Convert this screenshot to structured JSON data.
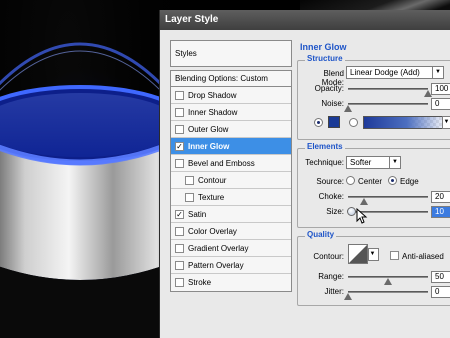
{
  "dialog": {
    "title": "Layer Style"
  },
  "left_panel": {
    "styles_label": "Styles",
    "blending_options_label": "Blending Options: Custom",
    "effects": [
      {
        "label": "Drop Shadow",
        "checked": false,
        "selected": false,
        "indent": false
      },
      {
        "label": "Inner Shadow",
        "checked": false,
        "selected": false,
        "indent": false
      },
      {
        "label": "Outer Glow",
        "checked": false,
        "selected": false,
        "indent": false
      },
      {
        "label": "Inner Glow",
        "checked": true,
        "selected": true,
        "indent": false
      },
      {
        "label": "Bevel and Emboss",
        "checked": false,
        "selected": false,
        "indent": false
      },
      {
        "label": "Contour",
        "checked": false,
        "selected": false,
        "indent": true
      },
      {
        "label": "Texture",
        "checked": false,
        "selected": false,
        "indent": true
      },
      {
        "label": "Satin",
        "checked": true,
        "selected": false,
        "indent": false
      },
      {
        "label": "Color Overlay",
        "checked": false,
        "selected": false,
        "indent": false
      },
      {
        "label": "Gradient Overlay",
        "checked": false,
        "selected": false,
        "indent": false
      },
      {
        "label": "Pattern Overlay",
        "checked": false,
        "selected": false,
        "indent": false
      },
      {
        "label": "Stroke",
        "checked": false,
        "selected": false,
        "indent": false
      }
    ]
  },
  "inner_glow": {
    "title": "Inner Glow",
    "structure": {
      "title": "Structure",
      "blend_mode_label": "Blend Mode:",
      "blend_mode_value": "Linear Dodge (Add)",
      "opacity_label": "Opacity:",
      "opacity_value": "100",
      "opacity_level": 1.0,
      "noise_label": "Noise:",
      "noise_value": "0",
      "noise_level": 0.0,
      "percent_sign": "%",
      "color": "#1a3a96"
    },
    "elements": {
      "title": "Elements",
      "technique_label": "Technique:",
      "technique_value": "Softer",
      "source_label": "Source:",
      "source_center_label": "Center",
      "source_edge_label": "Edge",
      "source_selected": "Edge",
      "choke_label": "Choke:",
      "choke_value": "20",
      "choke_level": 0.2,
      "size_label": "Size:",
      "size_value": "10",
      "size_level": 0.04
    },
    "quality": {
      "title": "Quality",
      "contour_label": "Contour:",
      "anti_aliased_label": "Anti-aliased",
      "anti_aliased_checked": false,
      "range_label": "Range:",
      "range_value": "50",
      "range_level": 0.5,
      "jitter_label": "Jitter:",
      "jitter_value": "0",
      "jitter_level": 0.0
    }
  },
  "icons": [
    "dropdown-arrow-icon",
    "checkmark-icon",
    "mouse-cursor-icon",
    "slider-thumb-icon"
  ],
  "colors": {
    "accent": "#1f55c8",
    "selection": "#3d8fe6",
    "glow_color": "#1a3a96"
  }
}
